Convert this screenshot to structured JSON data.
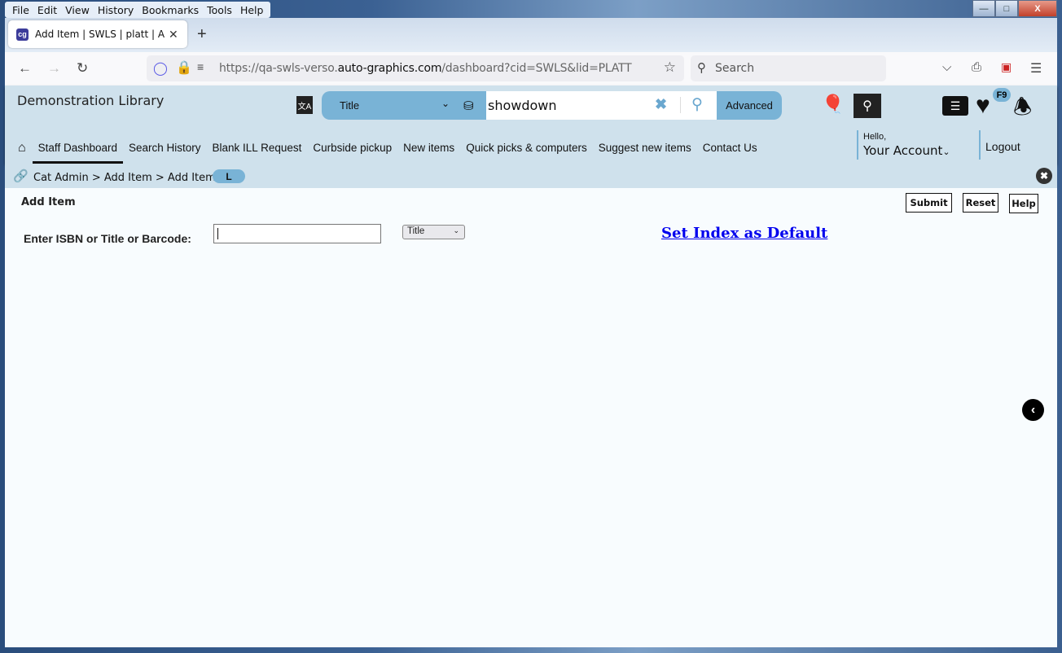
{
  "browser": {
    "menu": [
      "File",
      "Edit",
      "View",
      "History",
      "Bookmarks",
      "Tools",
      "Help"
    ],
    "tab_title": "Add Item | SWLS | platt | Auto-Graphics",
    "tab_favicon": "cg",
    "url_prefix": "https://qa-swls-verso.",
    "url_domain": "auto-graphics.com",
    "url_suffix": "/dashboard?cid=SWLS&lid=PLATT",
    "search_placeholder": "Search"
  },
  "header": {
    "library_name": "Demonstration Library",
    "search_index": "Title",
    "search_value": "showdown",
    "advanced_label": "Advanced",
    "favorites_badge": "F9",
    "hello": "Hello,",
    "account": "Your Account",
    "logout": "Logout"
  },
  "nav": {
    "items": [
      "Staff Dashboard",
      "Search History",
      "Blank ILL Request",
      "Curbside pickup",
      "New items",
      "Quick picks & computers",
      "Suggest new items",
      "Contact Us"
    ],
    "active": "Staff Dashboard"
  },
  "breadcrumb": {
    "path": "Cat Admin > Add Item > Add Item",
    "pill": "L"
  },
  "form": {
    "title": "Add Item",
    "submit": "Submit",
    "reset": "Reset",
    "help": "Help",
    "label": "Enter ISBN or Title or Barcode:",
    "input_value": "",
    "index_select": "Title",
    "set_default": "Set Index as Default"
  },
  "colors": {
    "header_bg": "#cfe1ec",
    "accent": "#79b3d6",
    "link": "#0000ee"
  }
}
